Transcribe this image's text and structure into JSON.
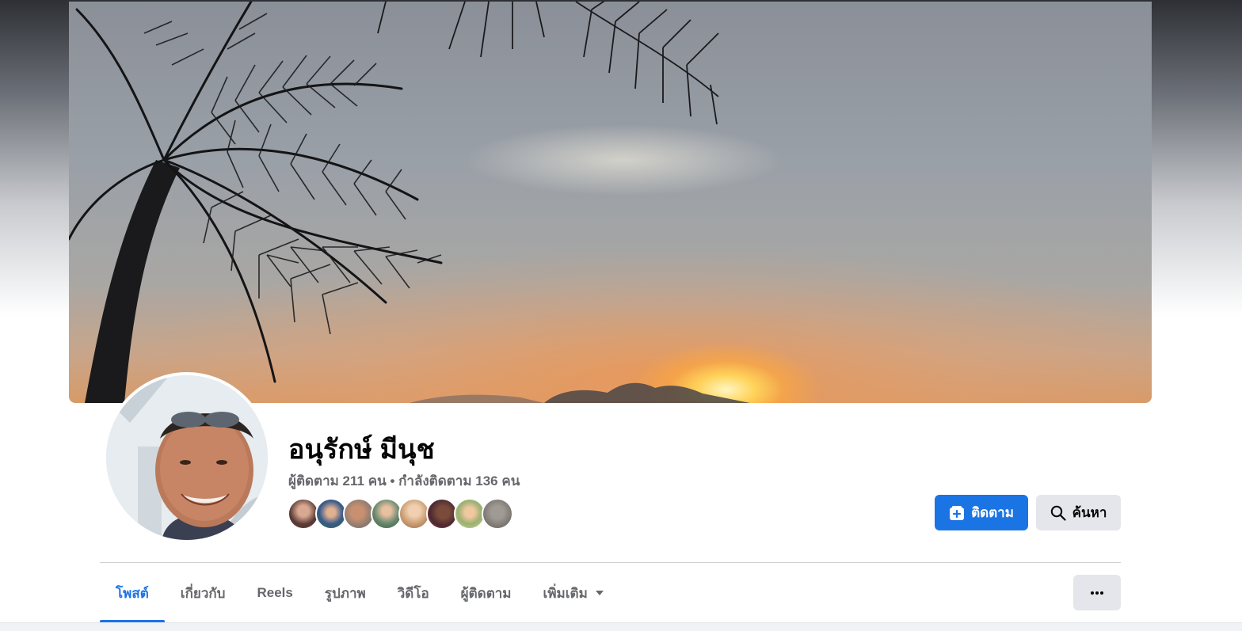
{
  "profile": {
    "name": "อนุรักษ์ มีนุช",
    "followers_text": "ผู้ติดตาม 211 คน",
    "separator": "•",
    "following_text": "กำลังติดตาม 136 คน"
  },
  "friends": [
    {
      "color": "#5a3a35"
    },
    {
      "color": "#3a5a8a"
    },
    {
      "color": "#8a7a70"
    },
    {
      "color": "#6a8a70"
    },
    {
      "color": "#c89a70"
    },
    {
      "color": "#4a2a30"
    },
    {
      "color": "#9ab070"
    },
    {
      "color": "#7a7470"
    }
  ],
  "actions": {
    "follow_label": "ติดตาม",
    "search_label": "ค้นหา"
  },
  "tabs": [
    {
      "label": "โพสต์",
      "active": true
    },
    {
      "label": "เกี่ยวกับ",
      "active": false
    },
    {
      "label": "Reels",
      "active": false
    },
    {
      "label": "รูปภาพ",
      "active": false
    },
    {
      "label": "วิดีโอ",
      "active": false
    },
    {
      "label": "ผู้ติดตาม",
      "active": false
    },
    {
      "label": "เพิ่มเติม",
      "active": false
    }
  ],
  "colors": {
    "accent": "#1b74e4",
    "secondary_button": "#e4e6eb",
    "muted_text": "#65676b"
  },
  "icons": {
    "follow": "follow-add-icon",
    "search": "search-icon",
    "more": "more-options-icon",
    "dropdown": "chevron-down-icon"
  }
}
